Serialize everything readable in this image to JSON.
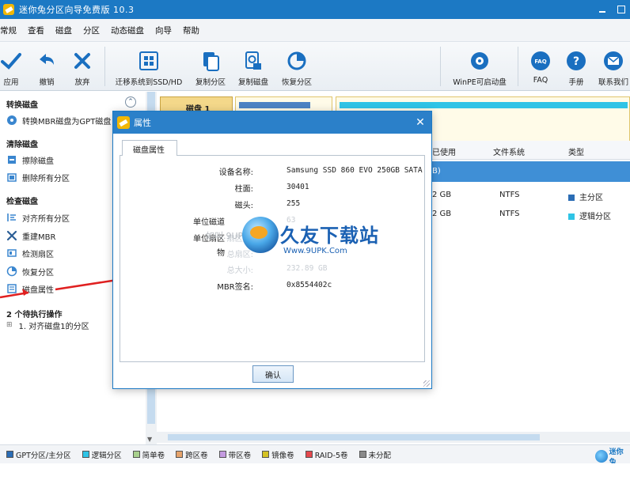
{
  "window": {
    "title": "迷你兔分区向导免费版 10.3"
  },
  "menu": [
    "常规",
    "查看",
    "磁盘",
    "分区",
    "动态磁盘",
    "向导",
    "帮助"
  ],
  "toolbar": {
    "apply": "应用",
    "undo": "撤销",
    "discard": "放弃",
    "migrate": "迁移系统到SSD/HD",
    "copy_partition": "复制分区",
    "copy_disk": "复制磁盘",
    "recover_partition": "恢复分区",
    "winpe": "WinPE可启动盘",
    "faq": "FAQ",
    "manual": "手册",
    "contact": "联系我们"
  },
  "sidebar": {
    "convert_head": "转换磁盘",
    "convert_item": "转换MBR磁盘为GPT磁盘",
    "clean_head": "清除磁盘",
    "wipe_disk": "擦除磁盘",
    "delete_all": "删除所有分区",
    "check_head": "检查磁盘",
    "align_all": "对齐所有分区",
    "rebuild_mbr": "重建MBR",
    "surface_test": "检测扇区",
    "recover_partition": "恢复分区",
    "disk_properties": "磁盘属性",
    "pending_head": "2 个待执行操作",
    "pending_item": "1. 对齐磁盘1的分区"
  },
  "diskmap": {
    "disk_label": "磁盘 1"
  },
  "table": {
    "headers": {
      "used": "已使用",
      "fs": "文件系统",
      "type": "类型"
    },
    "selected_suffix": "B)",
    "rows": [
      {
        "used": "2 GB",
        "fs": "NTFS",
        "type": "主分区",
        "color": "#2b6db5"
      },
      {
        "used": "2 GB",
        "fs": "NTFS",
        "type": "逻辑分区",
        "color": "#2fc4e6"
      }
    ]
  },
  "dialog": {
    "title": "属性",
    "tab": "磁盘属性",
    "props": {
      "device_name_label": "设备名称:",
      "device_name": "Samsung SSD 860 EVO 250GB SATA",
      "cylinders_label": "柱面:",
      "cylinders": "30401",
      "heads_label": "磁头:",
      "heads": "255",
      "sectors_label": "单位磁道",
      "sectors_value": "63",
      "sector_size_label": "单位扇区",
      "ghost_a": "扇区数:",
      "ghost_b": "总扇区:",
      "ghost_c": "总大小:",
      "total_size": "232.89 GB",
      "physical_label": "物",
      "mbr_label": "MBR签名:",
      "mbr_signature": "0x8554402c"
    },
    "ok": "确认"
  },
  "watermark": {
    "text": "久友下载站",
    "url": "Www.9UPK.Com",
    "gray": "如叫.9UPK.COM"
  },
  "legend": {
    "items": [
      {
        "label": "GPT分区/主分区",
        "color": "#2b6db5"
      },
      {
        "label": "逻辑分区",
        "color": "#2fc4e6"
      },
      {
        "label": "简单卷",
        "color": "#a8d08d"
      },
      {
        "label": "跨区卷",
        "color": "#e6a36b"
      },
      {
        "label": "带区卷",
        "color": "#c49be0"
      },
      {
        "label": "镜像卷",
        "color": "#d4c224"
      },
      {
        "label": "RAID-5卷",
        "color": "#e5484d"
      },
      {
        "label": "未分配",
        "color": "#8a8a8a"
      }
    ],
    "brand": "迷你兔"
  }
}
